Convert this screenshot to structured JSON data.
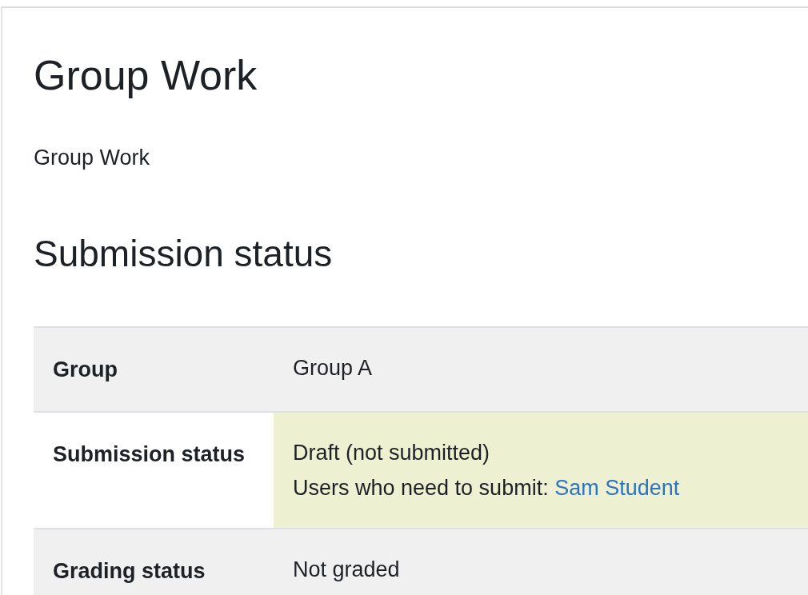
{
  "title": "Group Work",
  "intro": "Group Work",
  "section_heading": "Submission status",
  "table": {
    "rows": [
      {
        "header": "Group",
        "highlighted": false,
        "lines": [
          {
            "text": "Group A"
          }
        ]
      },
      {
        "header": "Submission status",
        "highlighted": true,
        "lines": [
          {
            "text": "Draft (not submitted)"
          },
          {
            "text": "Users who need to submit:",
            "link": "Sam Student"
          }
        ]
      },
      {
        "header": "Grading status",
        "highlighted": false,
        "lines": [
          {
            "text": "Not graded"
          }
        ]
      }
    ]
  }
}
